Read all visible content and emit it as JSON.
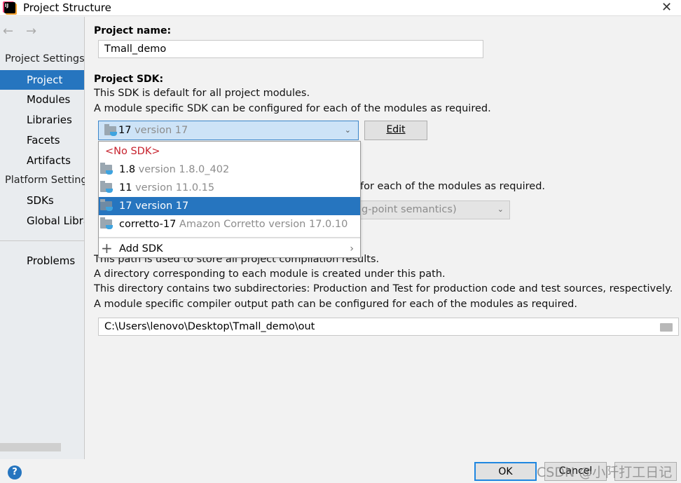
{
  "window": {
    "title": "Project Structure",
    "close": "✕"
  },
  "sidebar": {
    "back": "←",
    "forward": "→",
    "project_settings_header": "Project Settings",
    "project_items": [
      {
        "label": "Project",
        "selected": true
      },
      {
        "label": "Modules"
      },
      {
        "label": "Libraries"
      },
      {
        "label": "Facets"
      },
      {
        "label": "Artifacts"
      }
    ],
    "platform_settings_header": "Platform Settings",
    "platform_items": [
      {
        "label": "SDKs"
      },
      {
        "label": "Global Libraries"
      }
    ],
    "problems": "Problems"
  },
  "main": {
    "project_name_label": "Project name:",
    "project_name_value": "Tmall_demo",
    "sdk_label": "Project SDK:",
    "sdk_desc1": "This SDK is default for all project modules.",
    "sdk_desc2": "A module specific SDK can be configured for each of the modules as required.",
    "sdk_selected": {
      "name": "17",
      "detail": "version 17"
    },
    "edit_button": "Edit",
    "language_partial_desc": "for each of the modules as required.",
    "language_partial_value": "g-point semantics)",
    "output_desc_partial": "This path is used to store all project compilation results.",
    "output_desc2": "A directory corresponding to each module is created under this path.",
    "output_desc3": "This directory contains two subdirectories: Production and Test for production code and test sources, respectively.",
    "output_desc4": "A module specific compiler output path can be configured for each of the modules as required.",
    "output_path": "C:\\Users\\lenovo\\Desktop\\Tmall_demo\\out"
  },
  "sdk_popup": {
    "no_sdk": "<No SDK>",
    "options": [
      {
        "name": "1.8",
        "detail": "version 1.8.0_402"
      },
      {
        "name": "11",
        "detail": "version 11.0.15"
      },
      {
        "name": "17",
        "detail": "version 17",
        "selected": true
      },
      {
        "name": "corretto-17",
        "detail": "Amazon Corretto version 17.0.10"
      }
    ],
    "add_sdk": "Add SDK"
  },
  "footer": {
    "help": "?",
    "ok": "OK",
    "cancel": "Cancel",
    "watermark": "CSDN @小阡打工日记"
  },
  "colors": {
    "accent": "#2675bf",
    "no_sdk": "#c7222d",
    "combo_bg": "#cde3f7"
  }
}
